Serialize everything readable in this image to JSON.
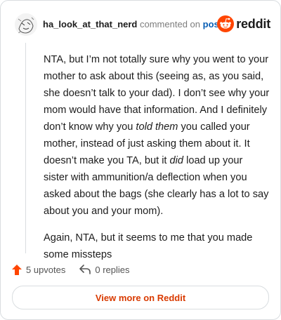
{
  "header": {
    "username": "ha_look_at_that_nerd",
    "action_text": "commented on",
    "post_link": "post",
    "brand": "reddit"
  },
  "comment": {
    "paragraphs": [
      {
        "parts": [
          "NTA, but I’m not totally sure why you went to your mother to ask about this (seeing as, as you said, she doesn’t talk to your dad). I don’t see why your mom would have that information. And I definitely don’t know why you ",
          "told them",
          " you called your mother, instead of just asking them about it. It doesn’t make you TA, but it ",
          "did",
          " load up your sister with ammunition/a deflection when you asked about the bags (she clearly has a lot to say about you and your mom)."
        ]
      },
      {
        "text": "Again, NTA, but it seems to me that you made some missteps"
      }
    ]
  },
  "actions": {
    "upvotes": "5 upvotes",
    "replies": "0 replies"
  },
  "footer": {
    "view_more": "View more on Reddit"
  },
  "colors": {
    "upvote": "#ff4500",
    "brand": "#ff4500",
    "link": "#0a5fb5",
    "view_more": "#d93a00"
  }
}
